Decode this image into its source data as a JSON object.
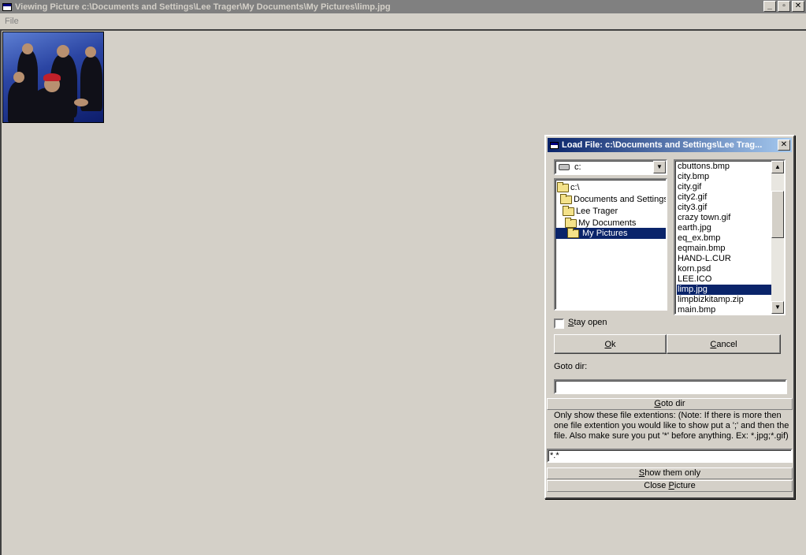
{
  "window": {
    "title": "Viewing Picture c:\\Documents and Settings\\Lee Trager\\My Documents\\My Pictures\\limp.jpg",
    "controls": {
      "minimize": "_",
      "maximize": "▫",
      "close": "✕"
    }
  },
  "menu": {
    "file": "File"
  },
  "dialog": {
    "title": "Load File: c:\\Documents and Settings\\Lee Trag...",
    "close": "✕",
    "drive": "c:",
    "tree": [
      {
        "label": "c:\\"
      },
      {
        "label": "Documents and Settings"
      },
      {
        "label": "Lee Trager"
      },
      {
        "label": "My Documents"
      },
      {
        "label": "My Pictures",
        "selected": true
      }
    ],
    "files": [
      "cbuttons.bmp",
      "city.bmp",
      "city.gif",
      "city2.gif",
      "city3.gif",
      "crazy town.gif",
      "earth.jpg",
      "eq_ex.bmp",
      "eqmain.bmp",
      "HAND-L.CUR",
      "korn.psd",
      "LEE.ICO",
      "limp.jpg",
      "limpbizkitamp.zip",
      "main.bmp"
    ],
    "selected_file": "limp.jpg",
    "stay_open_label": "Stay open",
    "stay_open_checked": false,
    "ok_label": "Ok",
    "cancel_label": "Cancel",
    "goto_label": "Goto dir:",
    "goto_value": "",
    "goto_button": "Goto dir",
    "ext_note": "Only show these file extentions: (Note: If there is more then one file extention you would like to show put a ';' and then the file. Also make sure you put '*' before anything. Ex: *.jpg;*.gif)",
    "ext_value": "*.*",
    "show_button": "Show them only",
    "close_button": "Close Picture"
  },
  "colors": {
    "face": "#d4d0c8",
    "selection": "#0a246a",
    "inactive_title": "#808080"
  }
}
